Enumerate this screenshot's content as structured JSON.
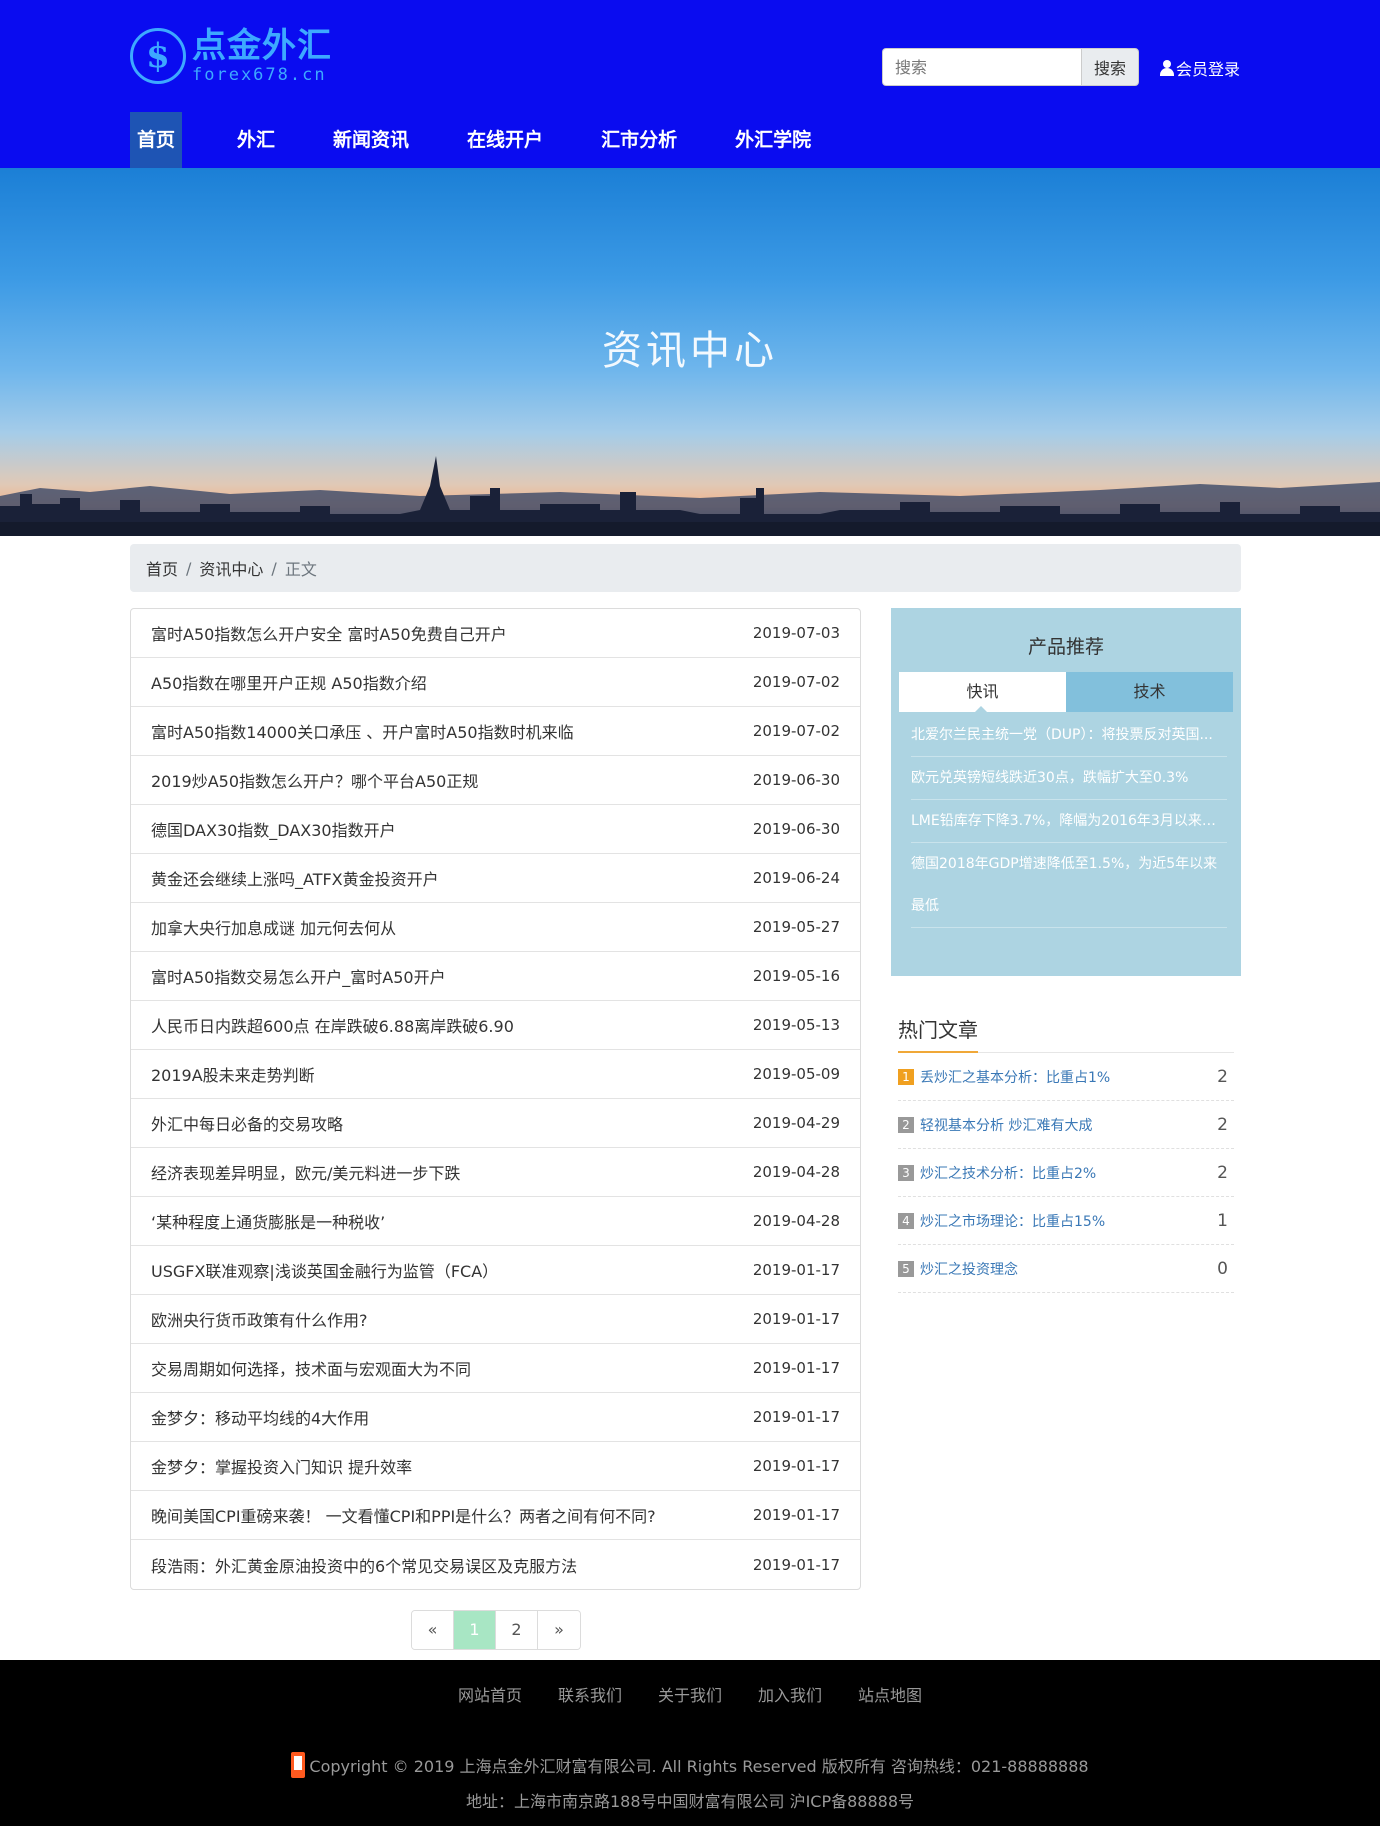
{
  "logo": {
    "mark": "$",
    "cn": "点金外汇",
    "en": "forex678.cn"
  },
  "search": {
    "placeholder": "搜索",
    "button": "搜索"
  },
  "login": {
    "label": "会员登录"
  },
  "nav": [
    "首页",
    "外汇",
    "新闻资讯",
    "在线开户",
    "汇市分析",
    "外汇学院"
  ],
  "banner": {
    "title": "资讯中心"
  },
  "breadcrumb": {
    "home": "首页",
    "section": "资讯中心",
    "current": "正文",
    "sep": "/"
  },
  "articles": [
    {
      "title": "富时A50指数怎么开户安全 富时A50免费自己开户",
      "date": "2019-07-03"
    },
    {
      "title": "A50指数在哪里开户正规 A50指数介绍",
      "date": "2019-07-02"
    },
    {
      "title": "富时A50指数14000关口承压 、开户富时A50指数时机来临",
      "date": "2019-07-02"
    },
    {
      "title": "2019炒A50指数怎么开户？哪个平台A50正规",
      "date": "2019-06-30"
    },
    {
      "title": "德国DAX30指数_DAX30指数开户",
      "date": "2019-06-30"
    },
    {
      "title": "黄金还会继续上涨吗_ATFX黄金投资开户",
      "date": "2019-06-24"
    },
    {
      "title": "加拿大央行加息成谜 加元何去何从",
      "date": "2019-05-27"
    },
    {
      "title": "富时A50指数交易怎么开户_富时A50开户",
      "date": "2019-05-16"
    },
    {
      "title": "人民币日内跌超600点 在岸跌破6.88离岸跌破6.90",
      "date": "2019-05-13"
    },
    {
      "title": "2019A股未来走势判断",
      "date": "2019-05-09"
    },
    {
      "title": "外汇中每日必备的交易攻略",
      "date": "2019-04-29"
    },
    {
      "title": "经济表现差异明显，欧元/美元料进一步下跌",
      "date": "2019-04-28"
    },
    {
      "title": "‘某种程度上通货膨胀是一种税收’",
      "date": "2019-04-28"
    },
    {
      "title": "USGFX联准观察|浅谈英国金融行为监管（FCA）",
      "date": "2019-01-17"
    },
    {
      "title": "欧洲央行货币政策有什么作用?",
      "date": "2019-01-17"
    },
    {
      "title": "交易周期如何选择，技术面与宏观面大为不同",
      "date": "2019-01-17"
    },
    {
      "title": "金梦夕：移动平均线的4大作用",
      "date": "2019-01-17"
    },
    {
      "title": "金梦夕：掌握投资入门知识 提升效率",
      "date": "2019-01-17"
    },
    {
      "title": "晚间美国CPI重磅来袭！ 一文看懂CPI和PPI是什么？两者之间有何不同?",
      "date": "2019-01-17"
    },
    {
      "title": "段浩雨：外汇黄金原油投资中的6个常见交易误区及克服方法",
      "date": "2019-01-17"
    }
  ],
  "pagination": {
    "prev": "«",
    "pages": [
      "1",
      "2"
    ],
    "next": "»",
    "current": 1
  },
  "product": {
    "title": "产品推荐",
    "tabs": [
      "快讯",
      "技术"
    ],
    "news": [
      "北爱尔兰民主统一党（DUP）：将投票反对英国...",
      "欧元兑英镑短线跌近30点，跌幅扩大至0.3%",
      "LME铅库存下降3.7%，降幅为2016年3月以来最大",
      "德国2018年GDP增速降低至1.5%，为近5年以来最低"
    ]
  },
  "hot": {
    "title": "热门文章",
    "items": [
      {
        "num": "1",
        "title": "丢炒汇之基本分析：比重占1%",
        "count": "2"
      },
      {
        "num": "2",
        "title": "轻视基本分析 炒汇难有大成",
        "count": "2"
      },
      {
        "num": "3",
        "title": "炒汇之技术分析：比重占2%",
        "count": "2"
      },
      {
        "num": "4",
        "title": "炒汇之市场理论：比重占15%",
        "count": "1"
      },
      {
        "num": "5",
        "title": "炒汇之投资理念",
        "count": "0"
      }
    ]
  },
  "footer": {
    "links": [
      "网站首页",
      "联系我们",
      "关于我们",
      "加入我们",
      "站点地图"
    ],
    "copyright": "Copyright © 2019 上海点金外汇财富有限公司. All Rights Reserved 版权所有 咨询热线：021-88888888",
    "address": "地址：上海市南京路188号中国财富有限公司 沪ICP备88888号"
  },
  "colors": {
    "header": "#0a0cf0",
    "accent": "#3da9ff",
    "active_nav": "#1e54b4",
    "product_bg": "#add4e2",
    "hot_underline": "#f0a838",
    "page_active": "#a8e6c4"
  }
}
